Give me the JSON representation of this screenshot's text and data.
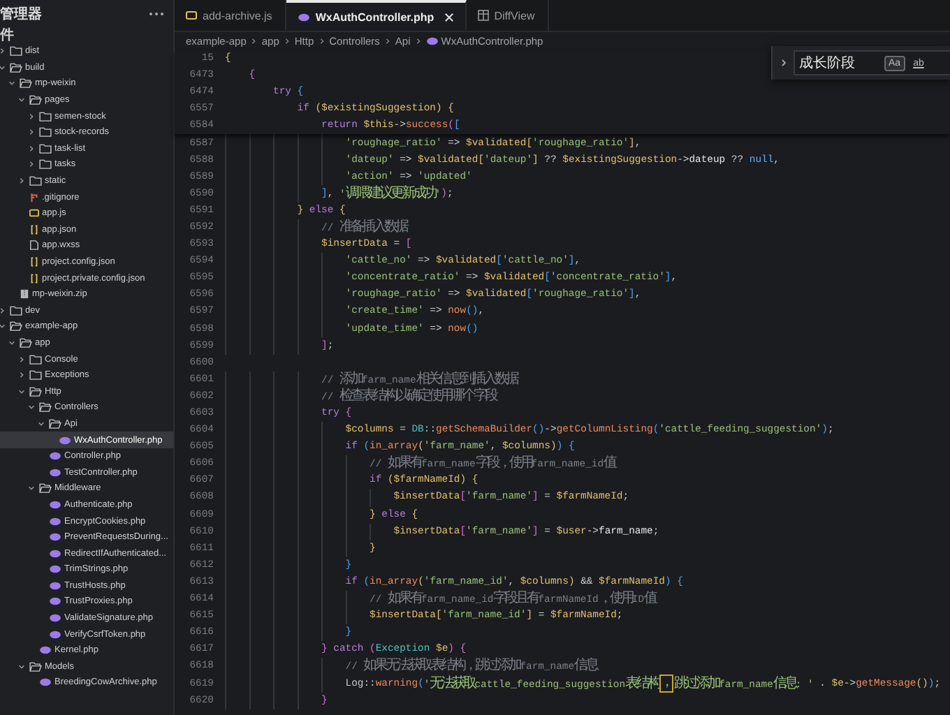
{
  "sidebar": {
    "title": "管理器",
    "section": "件",
    "items": [
      {
        "label": "dist",
        "kind": "folder",
        "expanded": false,
        "selected": false
      },
      {
        "label": "build",
        "kind": "folder",
        "expanded": true,
        "selected": false,
        "children": [
          {
            "label": "mp-weixin",
            "kind": "folder",
            "expanded": true,
            "selected": false,
            "children": [
              {
                "label": "pages",
                "kind": "folder",
                "expanded": true,
                "selected": false,
                "children": [
                  {
                    "label": "semen-stock",
                    "kind": "folder",
                    "expanded": false,
                    "selected": false
                  },
                  {
                    "label": "stock-records",
                    "kind": "folder",
                    "expanded": false,
                    "selected": false
                  },
                  {
                    "label": "task-list",
                    "kind": "folder",
                    "expanded": false,
                    "selected": false
                  },
                  {
                    "label": "tasks",
                    "kind": "folder",
                    "expanded": false,
                    "selected": false
                  }
                ]
              },
              {
                "label": "static",
                "kind": "folder",
                "expanded": false,
                "selected": false
              },
              {
                "label": ".gitignore",
                "kind": "git",
                "selected": false
              },
              {
                "label": "app.js",
                "kind": "js",
                "selected": false
              },
              {
                "label": "app.json",
                "kind": "json",
                "selected": false
              },
              {
                "label": "app.wxss",
                "kind": "file",
                "selected": false
              },
              {
                "label": "project.config.json",
                "kind": "json",
                "selected": false
              },
              {
                "label": "project.private.config.json",
                "kind": "json",
                "selected": false
              }
            ]
          },
          {
            "label": "mp-weixin.zip",
            "kind": "zip",
            "selected": false
          }
        ]
      },
      {
        "label": "dev",
        "kind": "folder",
        "expanded": false,
        "selected": false
      },
      {
        "label": "example-app",
        "kind": "folder",
        "expanded": true,
        "selected": false,
        "children": [
          {
            "label": "app",
            "kind": "folder",
            "expanded": true,
            "selected": false,
            "children": [
              {
                "label": "Console",
                "kind": "folder",
                "expanded": false,
                "selected": false
              },
              {
                "label": "Exceptions",
                "kind": "folder",
                "expanded": false,
                "selected": false
              },
              {
                "label": "Http",
                "kind": "folder",
                "expanded": true,
                "selected": false,
                "children": [
                  {
                    "label": "Controllers",
                    "kind": "folder",
                    "expanded": true,
                    "selected": false,
                    "children": [
                      {
                        "label": "Api",
                        "kind": "folder",
                        "expanded": true,
                        "selected": false,
                        "children": [
                          {
                            "label": "WxAuthController.php",
                            "kind": "php",
                            "selected": true
                          }
                        ]
                      },
                      {
                        "label": "Controller.php",
                        "kind": "php",
                        "selected": false
                      },
                      {
                        "label": "TestController.php",
                        "kind": "php",
                        "selected": false
                      }
                    ]
                  },
                  {
                    "label": "Middleware",
                    "kind": "folder",
                    "expanded": true,
                    "selected": false,
                    "children": [
                      {
                        "label": "Authenticate.php",
                        "kind": "php",
                        "selected": false
                      },
                      {
                        "label": "EncryptCookies.php",
                        "kind": "php",
                        "selected": false
                      },
                      {
                        "label": "PreventRequestsDuring...",
                        "kind": "php",
                        "selected": false
                      },
                      {
                        "label": "RedirectIfAuthenticated...",
                        "kind": "php",
                        "selected": false
                      },
                      {
                        "label": "TrimStrings.php",
                        "kind": "php",
                        "selected": false
                      },
                      {
                        "label": "TrustHosts.php",
                        "kind": "php",
                        "selected": false
                      },
                      {
                        "label": "TrustProxies.php",
                        "kind": "php",
                        "selected": false
                      },
                      {
                        "label": "ValidateSignature.php",
                        "kind": "php",
                        "selected": false
                      },
                      {
                        "label": "VerifyCsrfToken.php",
                        "kind": "php",
                        "selected": false
                      }
                    ]
                  },
                  {
                    "label": "Kernel.php",
                    "kind": "php",
                    "selected": false
                  }
                ]
              },
              {
                "label": "Models",
                "kind": "folder",
                "expanded": true,
                "selected": false,
                "children": [
                  {
                    "label": "BreedingCowArchive.php",
                    "kind": "php",
                    "selected": false
                  }
                ]
              }
            ]
          }
        ]
      }
    ]
  },
  "tabs": [
    {
      "label": "add-archive.js",
      "kind": "js",
      "selected": false
    },
    {
      "label": "WxAuthController.php",
      "kind": "php",
      "selected": true
    },
    {
      "label": "DiffView",
      "kind": "diff",
      "selected": false
    }
  ],
  "breadcrumb": [
    {
      "label": "example-app",
      "kind": "plain"
    },
    {
      "label": "app",
      "kind": "plain"
    },
    {
      "label": "Http",
      "kind": "plain"
    },
    {
      "label": "Controllers",
      "kind": "plain"
    },
    {
      "label": "Api",
      "kind": "plain"
    },
    {
      "label": "WxAuthController.php",
      "kind": "php"
    }
  ],
  "search": {
    "value": "成长阶段",
    "options": [
      {
        "label": "Aa",
        "on": true
      },
      {
        "label": "ab",
        "on": false
      }
    ]
  },
  "sticky_lines": [
    {
      "number": "15",
      "tokens": [
        {
          "kind": "br1",
          "text": "{"
        }
      ]
    },
    {
      "number": "6473",
      "tokens": [
        {
          "kind": "br2",
          "text": "    {"
        }
      ]
    },
    {
      "number": "6474",
      "tokens": [
        {
          "kind": "kw",
          "text": "        try "
        },
        {
          "kind": "br3",
          "text": "{"
        }
      ]
    },
    {
      "number": "6557",
      "tokens": [
        {
          "kind": "kw",
          "text": "            if "
        },
        {
          "kind": "br1",
          "text": "("
        },
        {
          "kind": "var",
          "text": "$existingSuggestion"
        },
        {
          "kind": "br1",
          "text": ") {"
        }
      ]
    },
    {
      "number": "6584",
      "tokens": [
        {
          "kind": "kw",
          "text": "                return "
        },
        {
          "kind": "var",
          "text": "$this"
        },
        {
          "kind": "op",
          "text": "->"
        },
        {
          "kind": "fn",
          "text": "success"
        },
        {
          "kind": "br2",
          "text": "("
        },
        {
          "kind": "br3",
          "text": "["
        }
      ]
    }
  ],
  "code_lines": [
    {
      "number": "6587",
      "tokens": [
        {
          "kind": "str",
          "text": "                    'roughage_ratio'"
        },
        {
          "kind": "op",
          "text": " => "
        },
        {
          "kind": "var",
          "text": "$validated"
        },
        {
          "kind": "br1",
          "text": "["
        },
        {
          "kind": "str",
          "text": "'roughage_ratio'"
        },
        {
          "kind": "br1",
          "text": "]"
        },
        {
          "kind": "op",
          "text": ","
        }
      ]
    },
    {
      "number": "6588",
      "tokens": [
        {
          "kind": "str",
          "text": "                    'dateup'"
        },
        {
          "kind": "op",
          "text": " => "
        },
        {
          "kind": "var",
          "text": "$validated"
        },
        {
          "kind": "br1",
          "text": "["
        },
        {
          "kind": "str",
          "text": "'dateup'"
        },
        {
          "kind": "br1",
          "text": "]"
        },
        {
          "kind": "op",
          "text": " ?? "
        },
        {
          "kind": "var",
          "text": "$existingSuggestion"
        },
        {
          "kind": "op",
          "text": "->"
        },
        {
          "kind": "prop",
          "text": "dateup"
        },
        {
          "kind": "op",
          "text": " ?? "
        },
        {
          "kind": "const",
          "text": "null"
        },
        {
          "kind": "op",
          "text": ","
        }
      ]
    },
    {
      "number": "6589",
      "tokens": [
        {
          "kind": "str",
          "text": "                    'action'"
        },
        {
          "kind": "op",
          "text": " => "
        },
        {
          "kind": "str",
          "text": "'updated'"
        }
      ]
    },
    {
      "number": "6590",
      "tokens": [
        {
          "kind": "br3",
          "text": "                ]"
        },
        {
          "kind": "op",
          "text": ", "
        },
        {
          "kind": "str",
          "text": "'调喂建议更新成功'"
        },
        {
          "kind": "br2",
          "text": ")"
        },
        {
          "kind": "op",
          "text": ";"
        }
      ]
    },
    {
      "number": "6591",
      "tokens": [
        {
          "kind": "br1",
          "text": "            } "
        },
        {
          "kind": "kw",
          "text": "else "
        },
        {
          "kind": "br1",
          "text": "{"
        }
      ]
    },
    {
      "number": "6592",
      "tokens": [
        {
          "kind": "comment",
          "text": "                // 准备插入数据"
        }
      ]
    },
    {
      "number": "6593",
      "tokens": [
        {
          "kind": "var",
          "text": "                $insertData"
        },
        {
          "kind": "op",
          "text": " = "
        },
        {
          "kind": "br2",
          "text": "["
        }
      ]
    },
    {
      "number": "6594",
      "tokens": [
        {
          "kind": "str",
          "text": "                    'cattle_no'"
        },
        {
          "kind": "op",
          "text": " => "
        },
        {
          "kind": "var",
          "text": "$validated"
        },
        {
          "kind": "br3",
          "text": "["
        },
        {
          "kind": "str",
          "text": "'cattle_no'"
        },
        {
          "kind": "br3",
          "text": "]"
        },
        {
          "kind": "op",
          "text": ","
        }
      ]
    },
    {
      "number": "6595",
      "tokens": [
        {
          "kind": "str",
          "text": "                    'concentrate_ratio'"
        },
        {
          "kind": "op",
          "text": " => "
        },
        {
          "kind": "var",
          "text": "$validated"
        },
        {
          "kind": "br3",
          "text": "["
        },
        {
          "kind": "str",
          "text": "'concentrate_ratio'"
        },
        {
          "kind": "br3",
          "text": "]"
        },
        {
          "kind": "op",
          "text": ","
        }
      ]
    },
    {
      "number": "6596",
      "tokens": [
        {
          "kind": "str",
          "text": "                    'roughage_ratio'"
        },
        {
          "kind": "op",
          "text": " => "
        },
        {
          "kind": "var",
          "text": "$validated"
        },
        {
          "kind": "br3",
          "text": "["
        },
        {
          "kind": "str",
          "text": "'roughage_ratio'"
        },
        {
          "kind": "br3",
          "text": "]"
        },
        {
          "kind": "op",
          "text": ","
        }
      ]
    },
    {
      "number": "6597",
      "tokens": [
        {
          "kind": "str",
          "text": "                    'create_time'"
        },
        {
          "kind": "op",
          "text": " => "
        },
        {
          "kind": "fn",
          "text": "now"
        },
        {
          "kind": "br3",
          "text": "()"
        },
        {
          "kind": "op",
          "text": ","
        }
      ]
    },
    {
      "number": "6598",
      "tokens": [
        {
          "kind": "str",
          "text": "                    'update_time'"
        },
        {
          "kind": "op",
          "text": " => "
        },
        {
          "kind": "fn",
          "text": "now"
        },
        {
          "kind": "br3",
          "text": "()"
        }
      ]
    },
    {
      "number": "6599",
      "tokens": [
        {
          "kind": "br2",
          "text": "                ]"
        },
        {
          "kind": "op",
          "text": ";"
        }
      ]
    },
    {
      "number": "6600"
    },
    {
      "number": "6601",
      "tokens": [
        {
          "kind": "comment",
          "text": "                // 添加farm_name相关信息到插入数据"
        }
      ]
    },
    {
      "number": "6602",
      "tokens": [
        {
          "kind": "comment",
          "text": "                // 检查表结构以确定使用哪个字段"
        }
      ]
    },
    {
      "number": "6603",
      "tokens": [
        {
          "kind": "kw",
          "text": "                try "
        },
        {
          "kind": "br2",
          "text": "{"
        }
      ]
    },
    {
      "number": "6604",
      "tokens": [
        {
          "kind": "var",
          "text": "                    $columns"
        },
        {
          "kind": "op",
          "text": " = "
        },
        {
          "kind": "cls",
          "text": "DB"
        },
        {
          "kind": "op",
          "text": "::"
        },
        {
          "kind": "fn",
          "text": "getSchemaBuilder"
        },
        {
          "kind": "br3",
          "text": "()"
        },
        {
          "kind": "op",
          "text": "->"
        },
        {
          "kind": "fn",
          "text": "getColumnListing"
        },
        {
          "kind": "br3",
          "text": "("
        },
        {
          "kind": "str",
          "text": "'cattle_feeding_suggestion'"
        },
        {
          "kind": "br3",
          "text": ")"
        },
        {
          "kind": "op",
          "text": ";"
        }
      ]
    },
    {
      "number": "6605",
      "tokens": [
        {
          "kind": "kw",
          "text": "                    if "
        },
        {
          "kind": "br3",
          "text": "("
        },
        {
          "kind": "fn",
          "text": "in_array"
        },
        {
          "kind": "br1",
          "text": "("
        },
        {
          "kind": "str",
          "text": "'farm_name'"
        },
        {
          "kind": "op",
          "text": ", "
        },
        {
          "kind": "var",
          "text": "$columns"
        },
        {
          "kind": "br1",
          "text": ")"
        },
        {
          "kind": "br3",
          "text": ") {"
        }
      ]
    },
    {
      "number": "6606",
      "tokens": [
        {
          "kind": "comment",
          "text": "                        // 如果有farm_name字段，使用farm_name_id值"
        }
      ]
    },
    {
      "number": "6607",
      "tokens": [
        {
          "kind": "kw",
          "text": "                        if "
        },
        {
          "kind": "br1",
          "text": "("
        },
        {
          "kind": "var",
          "text": "$farmNameId"
        },
        {
          "kind": "br1",
          "text": ") {"
        }
      ]
    },
    {
      "number": "6608",
      "tokens": [
        {
          "kind": "var",
          "text": "                            $insertData"
        },
        {
          "kind": "br2",
          "text": "["
        },
        {
          "kind": "str",
          "text": "'farm_name'"
        },
        {
          "kind": "br2",
          "text": "]"
        },
        {
          "kind": "op",
          "text": " = "
        },
        {
          "kind": "var",
          "text": "$farmNameId"
        },
        {
          "kind": "op",
          "text": ";"
        }
      ]
    },
    {
      "number": "6609",
      "tokens": [
        {
          "kind": "br1",
          "text": "                        } "
        },
        {
          "kind": "kw",
          "text": "else "
        },
        {
          "kind": "br1",
          "text": "{"
        }
      ]
    },
    {
      "number": "6610",
      "tokens": [
        {
          "kind": "var",
          "text": "                            $insertData"
        },
        {
          "kind": "br2",
          "text": "["
        },
        {
          "kind": "str",
          "text": "'farm_name'"
        },
        {
          "kind": "br2",
          "text": "]"
        },
        {
          "kind": "op",
          "text": " = "
        },
        {
          "kind": "var",
          "text": "$user"
        },
        {
          "kind": "op",
          "text": "->"
        },
        {
          "kind": "prop",
          "text": "farm_name"
        },
        {
          "kind": "op",
          "text": ";"
        }
      ]
    },
    {
      "number": "6611",
      "tokens": [
        {
          "kind": "br1",
          "text": "                        }"
        }
      ]
    },
    {
      "number": "6612",
      "tokens": [
        {
          "kind": "br3",
          "text": "                    }"
        }
      ]
    },
    {
      "number": "6613",
      "tokens": [
        {
          "kind": "kw",
          "text": "                    if "
        },
        {
          "kind": "br3",
          "text": "("
        },
        {
          "kind": "fn",
          "text": "in_array"
        },
        {
          "kind": "br1",
          "text": "("
        },
        {
          "kind": "str",
          "text": "'farm_name_id'"
        },
        {
          "kind": "op",
          "text": ", "
        },
        {
          "kind": "var",
          "text": "$columns"
        },
        {
          "kind": "br1",
          "text": ")"
        },
        {
          "kind": "op",
          "text": " && "
        },
        {
          "kind": "var",
          "text": "$farmNameId"
        },
        {
          "kind": "br3",
          "text": ") {"
        }
      ]
    },
    {
      "number": "6614",
      "tokens": [
        {
          "kind": "comment",
          "text": "                        // 如果有farm_name_id字段且有farmNameId，使用ID值"
        }
      ]
    },
    {
      "number": "6615",
      "tokens": [
        {
          "kind": "var",
          "text": "                        $insertData"
        },
        {
          "kind": "br1",
          "text": "["
        },
        {
          "kind": "str",
          "text": "'farm_name_id'"
        },
        {
          "kind": "br1",
          "text": "]"
        },
        {
          "kind": "op",
          "text": " = "
        },
        {
          "kind": "var",
          "text": "$farmNameId"
        },
        {
          "kind": "op",
          "text": ";"
        }
      ]
    },
    {
      "number": "6616",
      "tokens": [
        {
          "kind": "br3",
          "text": "                    }"
        }
      ]
    },
    {
      "number": "6617",
      "tokens": [
        {
          "kind": "br2",
          "text": "                } "
        },
        {
          "kind": "kw",
          "text": "catch "
        },
        {
          "kind": "br2",
          "text": "("
        },
        {
          "kind": "cls",
          "text": "Exception "
        },
        {
          "kind": "var",
          "text": "$e"
        },
        {
          "kind": "br2",
          "text": ") {"
        }
      ]
    },
    {
      "number": "6618",
      "tokens": [
        {
          "kind": "comment",
          "text": "                    // 如果无法获取表结构，跳过添加farm_name信息"
        }
      ]
    },
    {
      "number": "6619",
      "tokens": [
        {
          "kind": "plain",
          "text": "                    Log"
        },
        {
          "kind": "op",
          "text": "::"
        },
        {
          "kind": "fn",
          "text": "warning"
        },
        {
          "kind": "br3",
          "text": "("
        },
        {
          "kind": "str",
          "text": "'无法获取cattle_feeding_suggestion表结构"
        },
        {
          "kind": "str",
          "text": "，",
          "boxed": true
        },
        {
          "kind": "str",
          "text": "跳过添加farm_name信息: '"
        },
        {
          "kind": "op",
          "text": " . "
        },
        {
          "kind": "var",
          "text": "$e"
        },
        {
          "kind": "op",
          "text": "->"
        },
        {
          "kind": "fn",
          "text": "getMessage"
        },
        {
          "kind": "br1",
          "text": "()"
        },
        {
          "kind": "br3",
          "text": ")"
        },
        {
          "kind": "op",
          "text": ";"
        }
      ]
    },
    {
      "number": "6620",
      "tokens": [
        {
          "kind": "br2",
          "text": "                }"
        }
      ]
    }
  ]
}
